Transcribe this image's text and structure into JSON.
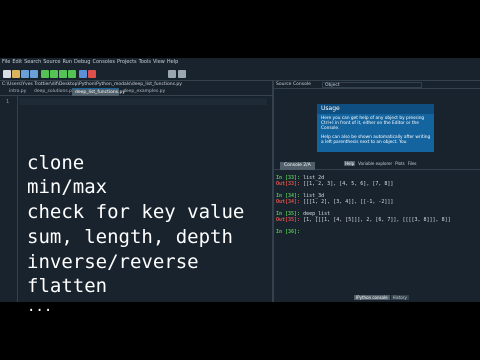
{
  "menu": [
    "File",
    "Edit",
    "Search",
    "Source",
    "Run",
    "Debug",
    "Consoles",
    "Projects",
    "Tools",
    "View",
    "Help"
  ],
  "toolbar_icons": [
    {
      "name": "new-file-icon",
      "color": "#d8dee4"
    },
    {
      "name": "open-folder-icon",
      "color": "#d9b45a"
    },
    {
      "name": "save-icon",
      "color": "#6a9fd8"
    },
    {
      "name": "save-all-icon",
      "color": "#6a9fd8"
    },
    {
      "name": "run-icon",
      "color": "#54c254"
    },
    {
      "name": "run-cell-icon",
      "color": "#54c254"
    },
    {
      "name": "run-cell-advance-icon",
      "color": "#54c254"
    },
    {
      "name": "run-selection-icon",
      "color": "#54c254"
    },
    {
      "name": "debug-icon",
      "color": "#5b8fd6"
    },
    {
      "name": "stop-icon",
      "color": "#e0504a"
    },
    {
      "name": "maximize-icon",
      "color": "#9aa6b0"
    },
    {
      "name": "preferences-icon",
      "color": "#9aa6b0"
    }
  ],
  "editor": {
    "path": "C:\\Users\\Yves Trottier\\dif\\Desktop\\Python\\Python_modals\\deep_list_functions.py",
    "tabs": [
      "intro.py",
      "deep_solutions.py",
      "deep_list_functions.py",
      "deep_examples.py"
    ],
    "line_number": "1",
    "big_lines": [
      "clone",
      "min/max",
      "check for key value",
      "sum, length, depth",
      "inverse/reverse",
      "flatten",
      "..."
    ]
  },
  "right_pane": {
    "top_tabs": [
      "Source",
      "Console"
    ],
    "object_label": "Object",
    "usage_title": "Usage",
    "usage_p1": "Here you can get help of any object by pressing Ctrl+I in front of it, either on the Editor or the Console.",
    "usage_p2": "Help can also be shown automatically after writing a left parenthesis next to an object. You",
    "help_tabs": [
      "Help",
      "Variable explorer",
      "Plots",
      "Files"
    ],
    "console_tab": "Console 2/A",
    "console_lines": [
      {
        "prompt": "In [33]:",
        "kind": "in",
        "text": " list_2d"
      },
      {
        "prompt": "Out[33]:",
        "kind": "out",
        "text": " [[1, 2, 3], [4, 5, 6], [7, 8]]"
      },
      {
        "prompt": "In [34]:",
        "kind": "in",
        "text": " list_3d"
      },
      {
        "prompt": "Out[34]:",
        "kind": "out",
        "text": " [[[1, 2], [3, 4]], [[-1, -2]]]"
      },
      {
        "prompt": "In [35]:",
        "kind": "in",
        "text": " deep_list"
      },
      {
        "prompt": "Out[35]:",
        "kind": "out",
        "text": " [1, [[[1, [4, [5]]], 2, [6, 7]], [[[[3, 8]]], 8]]"
      },
      {
        "prompt": "In [36]:",
        "kind": "in",
        "text": ""
      }
    ],
    "bottom_tabs": [
      "IPython console",
      "History"
    ]
  }
}
